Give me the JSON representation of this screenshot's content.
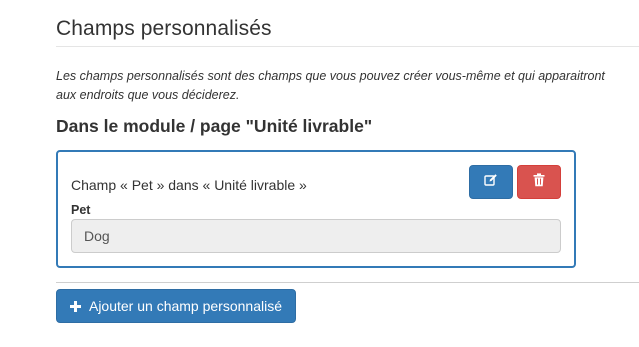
{
  "section": {
    "title": "Champs personnalisés",
    "description": "Les champs personnalisés sont des champs que vous pouvez créer vous-même et qui apparaitront aux endroits que vous déciderez."
  },
  "module": {
    "heading": "Dans le module / page \"Unité livrable\""
  },
  "field_card": {
    "caption": "Champ « Pet » dans « Unité livrable »",
    "field_label": "Pet",
    "field_value": "Dog",
    "edit_icon": "edit-icon",
    "delete_icon": "trash-icon"
  },
  "actions": {
    "add_label": "Ajouter un champ personnalisé",
    "add_icon": "plus-icon"
  },
  "colors": {
    "primary": "#337ab7",
    "danger": "#d9534f",
    "readonly_bg": "#eeeeee"
  }
}
